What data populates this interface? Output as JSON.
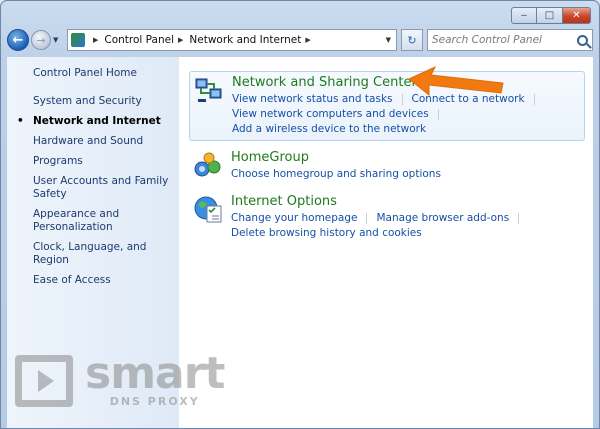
{
  "window": {
    "minimize_glyph": "‒",
    "maximize_glyph": "□",
    "close_glyph": "✕"
  },
  "nav": {
    "back_glyph": "←",
    "forward_glyph": "→",
    "dropdown_glyph": "▼",
    "breadcrumb_sep": "▶",
    "breadcrumbs": [
      "Control Panel",
      "Network and Internet"
    ],
    "refresh_glyph": "↻",
    "search_placeholder": "Search Control Panel"
  },
  "sidebar": {
    "items": [
      {
        "label": "Control Panel Home"
      },
      {
        "label": "System and Security"
      },
      {
        "label": "Network and Internet"
      },
      {
        "label": "Hardware and Sound"
      },
      {
        "label": "Programs"
      },
      {
        "label": "User Accounts and Family Safety"
      },
      {
        "label": "Appearance and Personalization"
      },
      {
        "label": "Clock, Language, and Region"
      },
      {
        "label": "Ease of Access"
      }
    ]
  },
  "categories": [
    {
      "title": "Network and Sharing Center",
      "links_row1": [
        "View network status and tasks",
        "Connect to a network"
      ],
      "links_row2": [
        "View network computers and devices"
      ],
      "links_row3": [
        "Add a wireless device to the network"
      ]
    },
    {
      "title": "HomeGroup",
      "links_row1": [
        "Choose homegroup and sharing options"
      ]
    },
    {
      "title": "Internet Options",
      "links_row1": [
        "Change your homepage",
        "Manage browser add-ons"
      ],
      "links_row2": [
        "Delete browsing history and cookies"
      ]
    }
  ],
  "colors": {
    "arrow": "#f07a10",
    "category_title": "#1e7a1e",
    "link": "#1550a5"
  },
  "watermark": {
    "brand": "smart",
    "sub": "DNS PROXY"
  }
}
